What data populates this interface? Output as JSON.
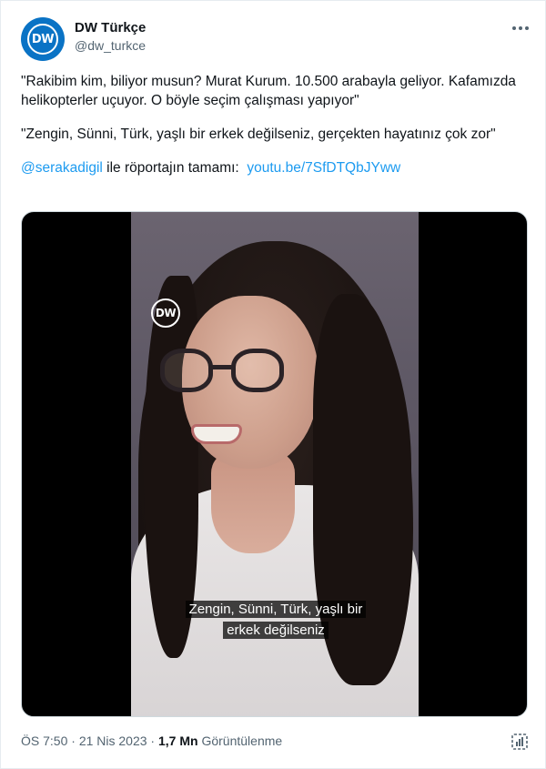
{
  "author": {
    "name": "DW Türkçe",
    "handle": "@dw_turkce",
    "avatar_text": "DW"
  },
  "tweet": {
    "line1": "\"Rakibim kim, biliyor musun? Murat Kurum. 10.500 arabayla geliyor. Kafamızda helikopterler uçuyor. O böyle seçim çalışması yapıyor\"",
    "line2": "\"Zengin, Sünni, Türk, yaşlı bir erkek değilseniz, gerçekten hayatınız çok zor\"",
    "mention": "@serakadigil",
    "mention_suffix": " ile röportajın tamamı:  ",
    "url": "youtu.be/7SfDTQbJYww"
  },
  "video": {
    "watermark": "DW",
    "caption_line1": "Zengin, Sünni, Türk, yaşlı bir",
    "caption_line2": "erkek değilseniz"
  },
  "meta": {
    "time": "ÖS 7:50",
    "sep1": " · ",
    "date": "21 Nis 2023",
    "sep2": " · ",
    "views": "1,7 Mn",
    "views_label": " Görüntülenme"
  },
  "icons": {
    "more": "more-dots-icon",
    "stats": "analytics-icon"
  },
  "colors": {
    "accent": "#1d9bf0",
    "brand": "#0a73c5",
    "secondary_text": "#536471"
  }
}
